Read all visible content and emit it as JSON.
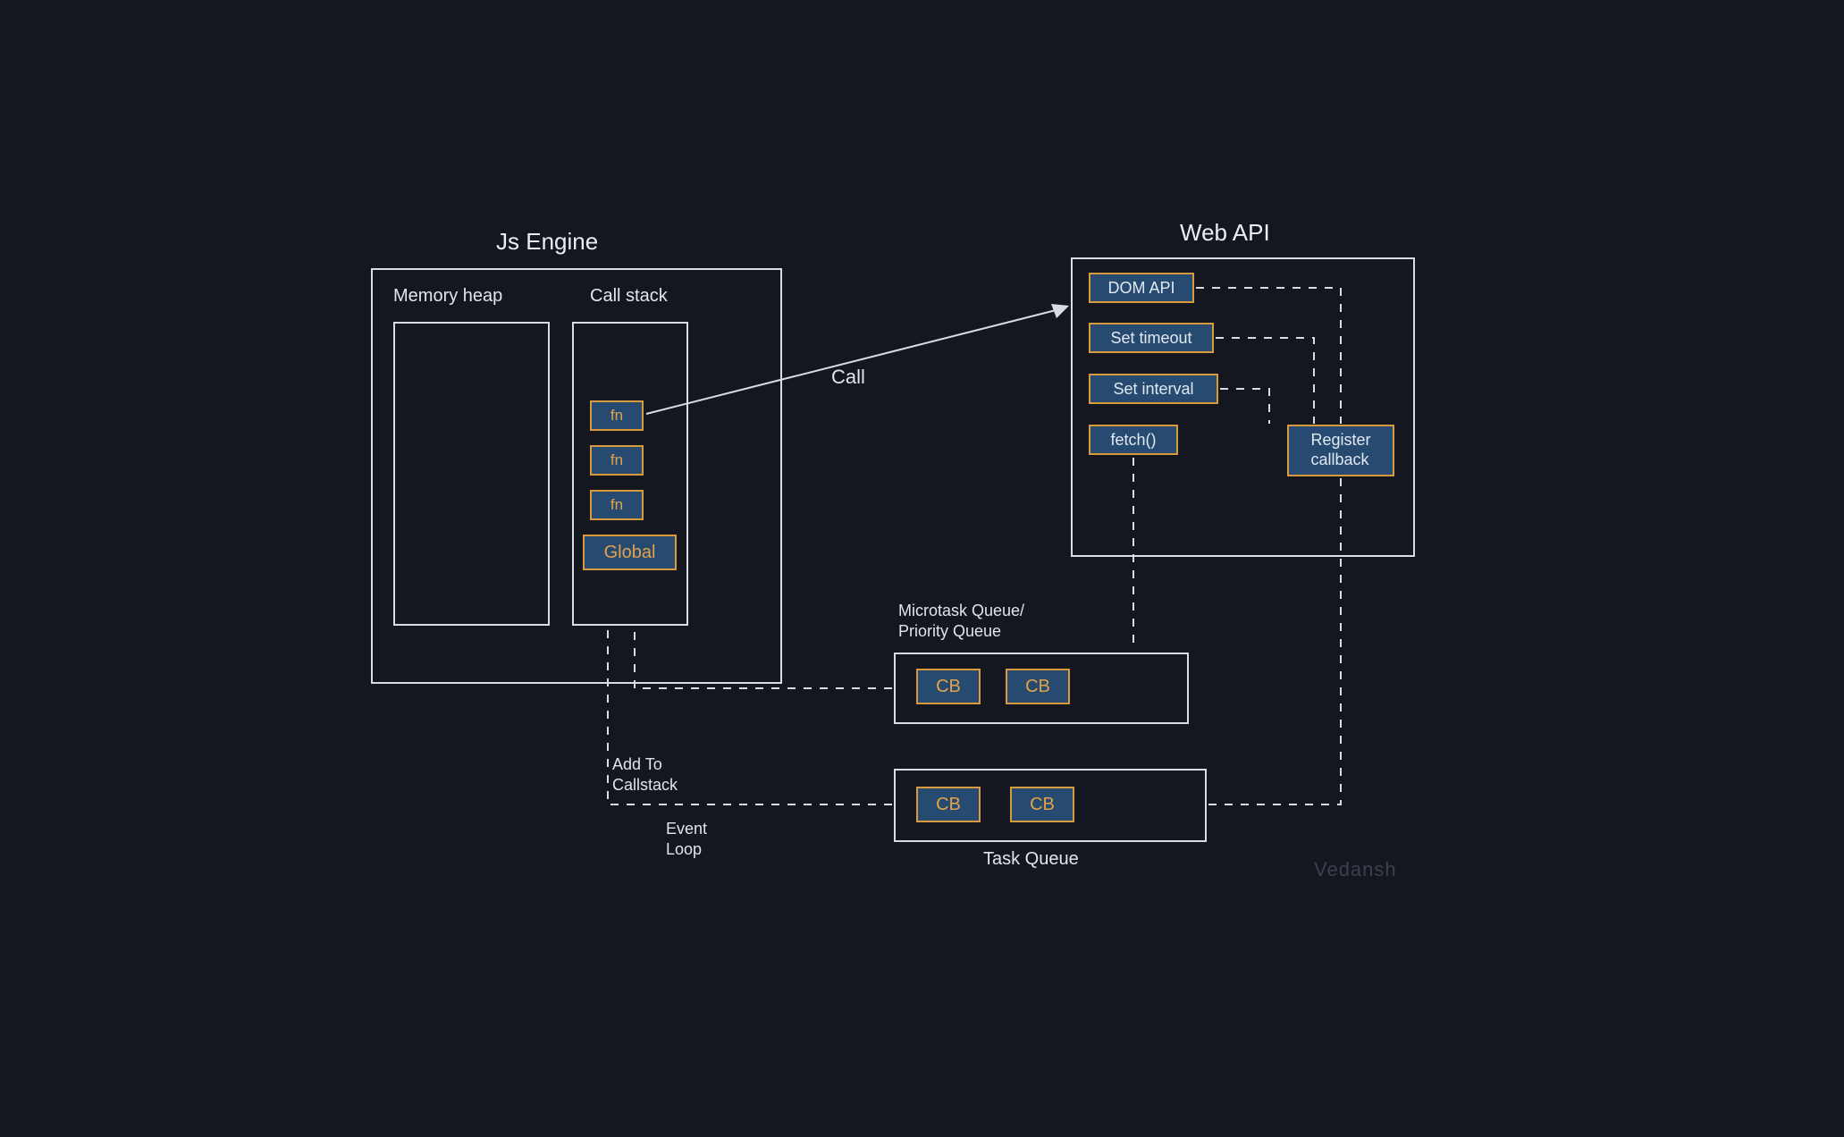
{
  "titles": {
    "jsEngine": "Js Engine",
    "webApi": "Web API",
    "memoryHeap": "Memory heap",
    "callStack": "Call stack",
    "microtask": "Microtask Queue/\nPriority Queue",
    "taskQueue": "Task Queue"
  },
  "labels": {
    "call": "Call",
    "addToCallstack": "Add To\nCallstack",
    "eventLoop": "Event\nLoop"
  },
  "callstack": {
    "fn1": "fn",
    "fn2": "fn",
    "fn3": "fn",
    "global": "Global"
  },
  "webapi": {
    "domApi": "DOM API",
    "setTimeout": "Set timeout",
    "setInterval": "Set interval",
    "fetch": "fetch()",
    "registerCallback": "Register\ncallback"
  },
  "microtaskQueue": {
    "cb1": "CB",
    "cb2": "CB"
  },
  "taskQueueItems": {
    "cb1": "CB",
    "cb2": "CB"
  },
  "watermark": "Vedansh",
  "colors": {
    "bg": "#14171f",
    "stroke": "#d7dde4",
    "chipFill": "#274a71",
    "chipBorder": "#d89a3a",
    "accentText": "#e2a24a"
  }
}
